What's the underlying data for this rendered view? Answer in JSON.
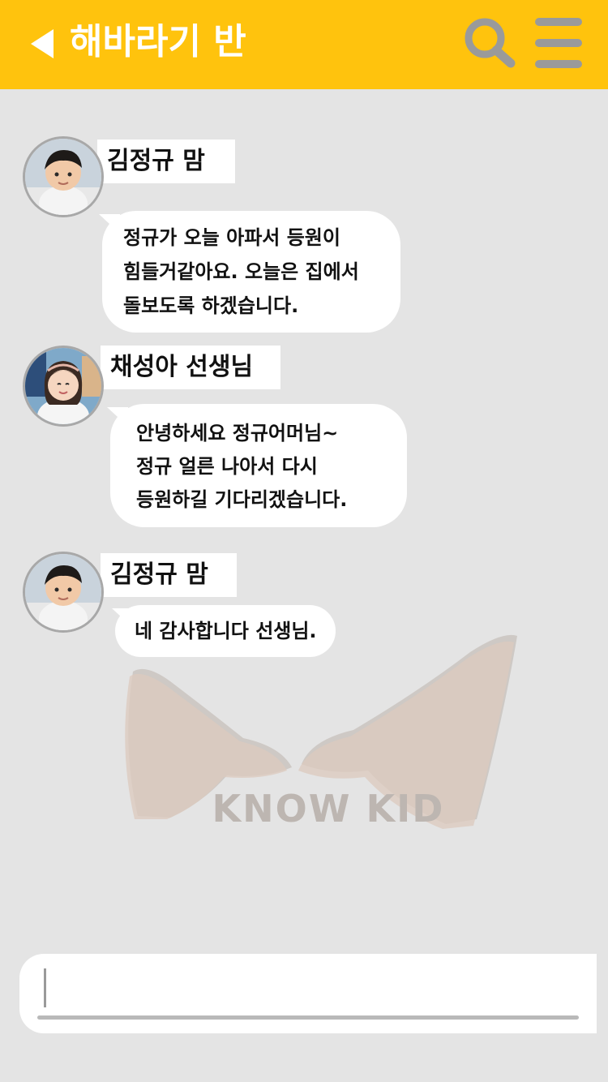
{
  "header": {
    "back_icon": "back-arrow-icon",
    "title": "해바라기 반",
    "search_icon": "search-icon",
    "menu_icon": "menu-icon",
    "background": "#ffc30d"
  },
  "messages": [
    {
      "sender": "김정규 맘",
      "avatar": "child-avatar",
      "lines": [
        "정규가 오늘 아파서 등원이",
        "힘들거같아요. 오늘은 집에서",
        "돌보도록 하겠습니다."
      ]
    },
    {
      "sender": "채성아 선생님",
      "avatar": "teacher-avatar",
      "lines": [
        "안녕하세요 정규어머님~",
        "정규 얼른 나아서 다시",
        "등원하길 기다리겠습니다."
      ]
    },
    {
      "sender": "김정규 맘",
      "avatar": "child-avatar",
      "lines": [
        "네 감사합니다 선생님."
      ]
    }
  ],
  "watermark": {
    "text": "KNOW KID",
    "icon": "kangaroo-logo-icon"
  },
  "input": {
    "value": ""
  }
}
